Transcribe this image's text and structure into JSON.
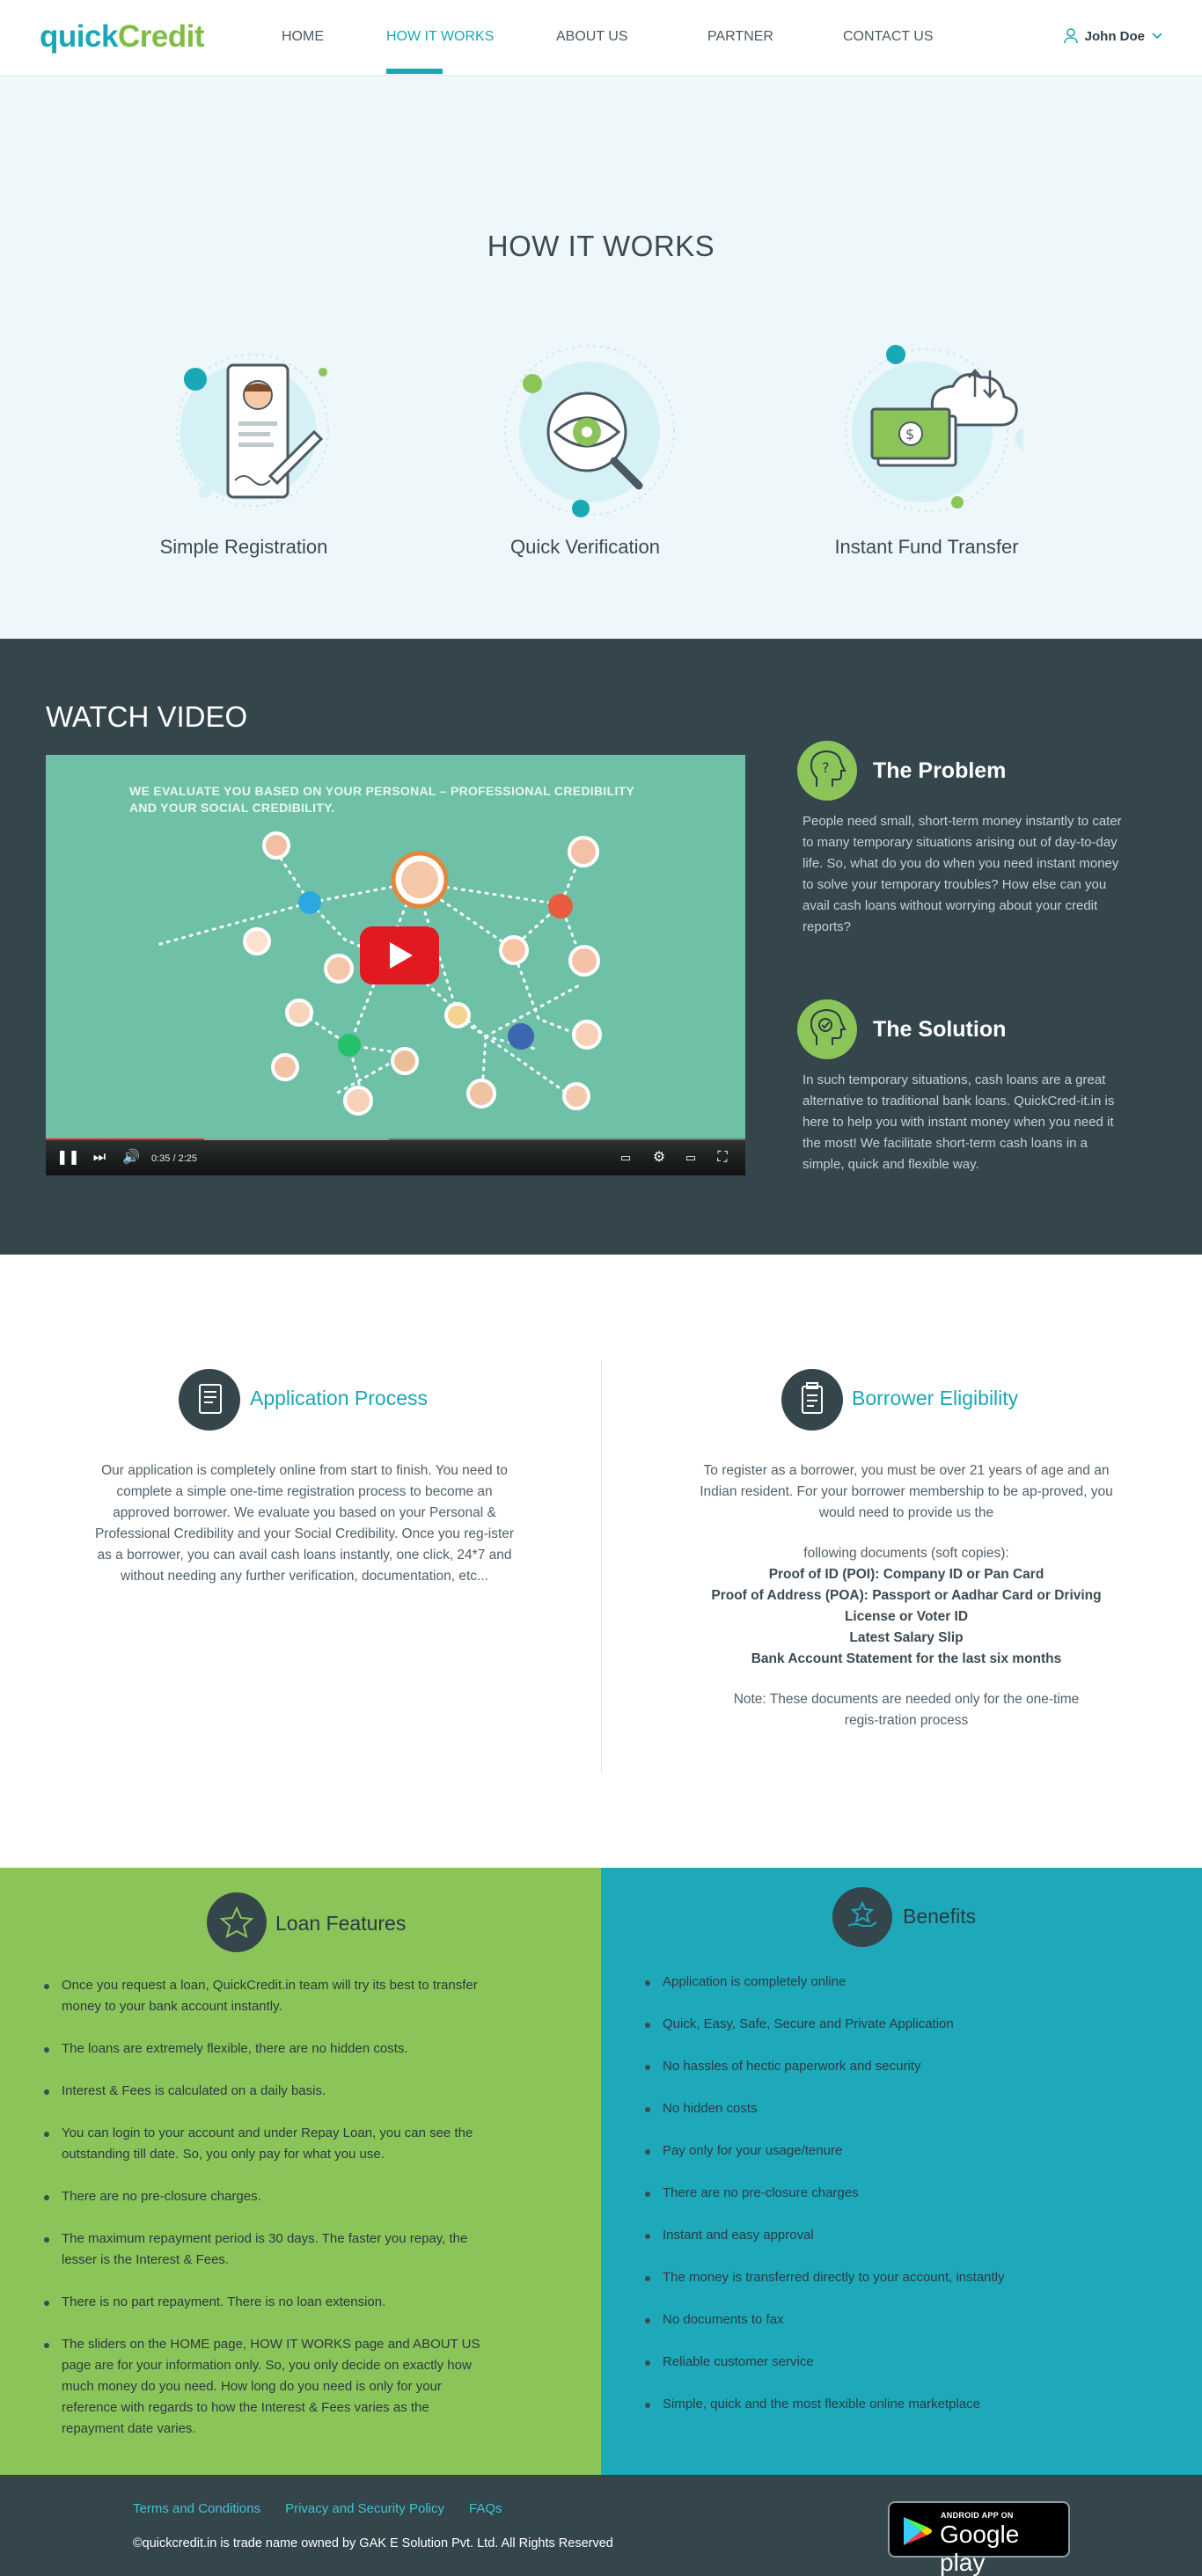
{
  "header": {
    "logo_q": "q",
    "logo_rest_quick": "uick",
    "logo_credit": "Credit",
    "nav": [
      "HOME",
      "HOW IT WORKS",
      "ABOUT US",
      "PARTNER",
      "CONTACT US"
    ],
    "active_nav": "HOW IT WORKS",
    "user_name": "John Doe"
  },
  "how_it_works": {
    "title": "HOW IT WORKS",
    "steps": [
      "Simple Registration",
      "Quick Verification",
      "Instant Fund Transfer"
    ]
  },
  "video": {
    "title": "WATCH VIDEO",
    "caption_line1": "WE EVALUATE YOU BASED ON YOUR PERSONAL – PROFESSIONAL CREDIBILITY",
    "caption_line2": "AND YOUR SOCIAL CREDIBILITY.",
    "time": "0:35 / 2:25",
    "progress_fraction": 0.241
  },
  "problem": {
    "title": "The Problem",
    "text": "People need small, short-term money instantly to cater to many temporary situations arising out of day-to-day life. So, what do you do when you need instant money to solve your temporary troubles? How else can you avail cash loans without worrying about your credit reports?"
  },
  "solution": {
    "title": "The Solution",
    "text": "In such temporary situations, cash loans are a great alternative to traditional bank loans. QuickCred-it.in is here to help you with instant money when you need it the most! We facilitate short-term cash loans in a simple, quick and flexible way."
  },
  "application": {
    "title": "Application Process",
    "text": "Our application is completely online from start to finish. You need to complete a simple one-time registration process to become an approved borrower. We evaluate you based on your Personal & Professional Credibility and your Social Credibility. Once you reg-ister as a borrower, you can avail cash loans instantly, one click, 24*7 and without needing any further verification, documentation, etc..."
  },
  "borrower": {
    "title": "Borrower Eligibility",
    "intro": "To register as a borrower, you must be over 21 years of age and an Indian resident. For your borrower membership to be ap-proved, you would need to provide us the",
    "docs_intro": "following documents (soft copies):",
    "docs": [
      "Proof of ID (POI): Company ID or Pan Card",
      "Proof of Address (POA): Passport or Aadhar Card or Driving License or Voter ID",
      "Latest Salary Slip",
      "Bank Account Statement for the last six months"
    ],
    "note": "Note: These documents are needed only for the one-time regis-tration process"
  },
  "loan_features": {
    "title": "Loan Features",
    "items": [
      "Once you request a loan, QuickCredit.in team will try its best to transfer money to your bank account instantly.",
      "The loans are extremely flexible, there are no hidden costs.",
      "Interest & Fees is calculated on a daily basis.",
      "You can login to your account and under Repay Loan, you can see the outstanding till date. So, you only pay for what you use.",
      "There are no pre-closure charges.",
      "The maximum repayment period is 30 days. The faster you repay, the lesser is the Interest & Fees.",
      "There is no part repayment. There is no loan extension.",
      "The sliders on the HOME page, HOW IT WORKS page and ABOUT US page are for your information only. So, you only decide on exactly how much money do you need. How long do you need is only for your reference with regards to how the Interest & Fees varies as the repayment date varies."
    ]
  },
  "benefits": {
    "title": "Benefits",
    "items": [
      "Application is completely online",
      "Quick, Easy, Safe, Secure and Private Application",
      "No hassles of hectic paperwork and security",
      "No hidden costs",
      "Pay only for your usage/tenure",
      "There are no pre-closure charges",
      "Instant and easy approval",
      "The money is transferred directly to your account, instantly",
      "No documents to fax",
      "Reliable customer service",
      "Simple, quick and the most flexible online marketplace"
    ]
  },
  "footer": {
    "links": [
      "Terms and Conditions",
      "Privacy and Security Policy",
      "FAQs"
    ],
    "copyright": "©quickcredit.in is trade name owned by GAK E Solution Pvt. Ltd. All Rights Reserved",
    "store_small": "ANDROID APP ON",
    "store_large": "Google play"
  },
  "colors": {
    "teal": "#1aa7b6",
    "green": "#8bc55a",
    "dark": "#34454c",
    "light_bg": "#eef8fa"
  }
}
